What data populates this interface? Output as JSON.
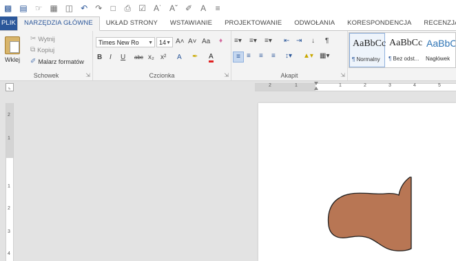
{
  "quick_access": {
    "icons": [
      "word-app-icon",
      "save-icon",
      "touch-mode-icon",
      "new-table-icon",
      "table-icon",
      "undo-icon",
      "redo-icon",
      "print-preview-icon",
      "print-icon",
      "spelling-icon",
      "increase-font-icon",
      "decrease-font-icon",
      "paint-icon",
      "text-effect-icon",
      "customize-dropdown-icon"
    ]
  },
  "tabs": [
    {
      "id": "plik",
      "label": "PLIK"
    },
    {
      "id": "narzedzia",
      "label": "NARZĘDZIA GŁÓWNE"
    },
    {
      "id": "uklad",
      "label": "UKŁAD STRONY"
    },
    {
      "id": "wstawianie",
      "label": "WSTAWIANIE"
    },
    {
      "id": "projektowanie",
      "label": "PROJEKTOWANIE"
    },
    {
      "id": "odwolania",
      "label": "ODWOŁANIA"
    },
    {
      "id": "korespondencja",
      "label": "KORESPONDENCJA"
    },
    {
      "id": "recenzja",
      "label": "RECENZJA"
    }
  ],
  "active_tab": "narzedzia",
  "clipboard": {
    "paste_label": "Wklej",
    "cut_label": "Wytnij",
    "copy_label": "Kopiuj",
    "format_painter_label": "Malarz formatów",
    "group_label": "Schowek"
  },
  "font": {
    "font_name": "Times New Ro",
    "font_size": "14",
    "grow_glyph": "A˄",
    "shrink_glyph": "A˅",
    "case_glyph": "Aa",
    "bold_glyph": "B",
    "italic_glyph": "I",
    "underline_glyph": "U",
    "strike_glyph": "abc",
    "subscript_glyph": "x₂",
    "superscript_glyph": "x²",
    "effects_glyph": "A",
    "color_glyph": "A",
    "group_label": "Czcionka"
  },
  "paragraph": {
    "sort_glyph": "↓",
    "pilcrow_glyph": "¶",
    "group_label": "Akapit"
  },
  "styles": {
    "items": [
      {
        "sample": "AaBbCc",
        "name": "Normalny",
        "selected": true
      },
      {
        "sample": "AaBbCc",
        "name": "Bez odst...",
        "selected": false
      },
      {
        "sample": "AaBbC",
        "name": "Nagłówek",
        "selected": false
      }
    ]
  },
  "ruler": {
    "h_numbers": [
      "2",
      "1",
      "1",
      "2",
      "3",
      "4",
      "5"
    ],
    "v_numbers": [
      "2",
      "1",
      "1",
      "2",
      "3",
      "4"
    ]
  },
  "colors": {
    "brand": "#2b579a",
    "shape_fill": "#b87654",
    "shape_stroke": "#1e1e1e",
    "workspace": "#e3e3e3"
  }
}
